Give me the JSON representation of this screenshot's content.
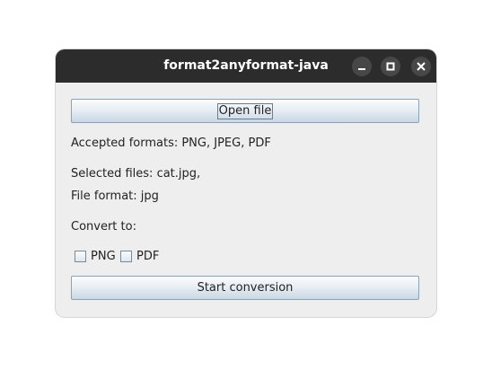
{
  "window": {
    "title": "format2anyformat-java",
    "controls": [
      "minimize-icon",
      "maximize-icon",
      "close-icon"
    ]
  },
  "main": {
    "open_button_label": "Open file",
    "accepted_formats_text": "Accepted formats: PNG, JPEG, PDF",
    "selected_files_text": "Selected files: cat.jpg,",
    "file_format_text": "File format: jpg",
    "convert_to_text": "Convert to:",
    "checkboxes": [
      {
        "label": "PNG",
        "checked": false
      },
      {
        "label": "PDF",
        "checked": false
      }
    ],
    "start_button_label": "Start conversion"
  },
  "colors": {
    "titlebar": "#2c2c2c",
    "window_bg": "#eeeeee",
    "button_border": "#8ea2b6"
  }
}
